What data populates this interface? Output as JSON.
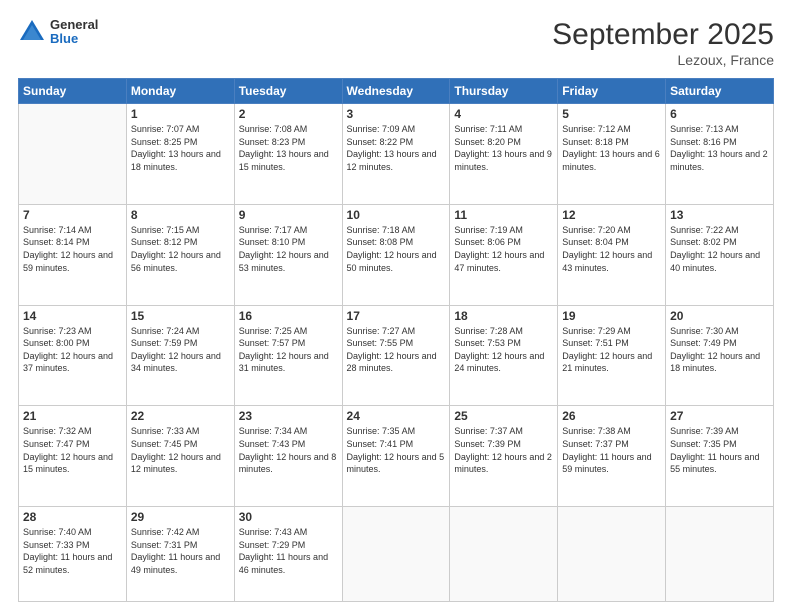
{
  "header": {
    "logo": {
      "general": "General",
      "blue": "Blue"
    },
    "title": "September 2025",
    "location": "Lezoux, France"
  },
  "weekdays": [
    "Sunday",
    "Monday",
    "Tuesday",
    "Wednesday",
    "Thursday",
    "Friday",
    "Saturday"
  ],
  "weeks": [
    [
      {
        "day": "",
        "sunrise": "",
        "sunset": "",
        "daylight": ""
      },
      {
        "day": "1",
        "sunrise": "Sunrise: 7:07 AM",
        "sunset": "Sunset: 8:25 PM",
        "daylight": "Daylight: 13 hours and 18 minutes."
      },
      {
        "day": "2",
        "sunrise": "Sunrise: 7:08 AM",
        "sunset": "Sunset: 8:23 PM",
        "daylight": "Daylight: 13 hours and 15 minutes."
      },
      {
        "day": "3",
        "sunrise": "Sunrise: 7:09 AM",
        "sunset": "Sunset: 8:22 PM",
        "daylight": "Daylight: 13 hours and 12 minutes."
      },
      {
        "day": "4",
        "sunrise": "Sunrise: 7:11 AM",
        "sunset": "Sunset: 8:20 PM",
        "daylight": "Daylight: 13 hours and 9 minutes."
      },
      {
        "day": "5",
        "sunrise": "Sunrise: 7:12 AM",
        "sunset": "Sunset: 8:18 PM",
        "daylight": "Daylight: 13 hours and 6 minutes."
      },
      {
        "day": "6",
        "sunrise": "Sunrise: 7:13 AM",
        "sunset": "Sunset: 8:16 PM",
        "daylight": "Daylight: 13 hours and 2 minutes."
      }
    ],
    [
      {
        "day": "7",
        "sunrise": "Sunrise: 7:14 AM",
        "sunset": "Sunset: 8:14 PM",
        "daylight": "Daylight: 12 hours and 59 minutes."
      },
      {
        "day": "8",
        "sunrise": "Sunrise: 7:15 AM",
        "sunset": "Sunset: 8:12 PM",
        "daylight": "Daylight: 12 hours and 56 minutes."
      },
      {
        "day": "9",
        "sunrise": "Sunrise: 7:17 AM",
        "sunset": "Sunset: 8:10 PM",
        "daylight": "Daylight: 12 hours and 53 minutes."
      },
      {
        "day": "10",
        "sunrise": "Sunrise: 7:18 AM",
        "sunset": "Sunset: 8:08 PM",
        "daylight": "Daylight: 12 hours and 50 minutes."
      },
      {
        "day": "11",
        "sunrise": "Sunrise: 7:19 AM",
        "sunset": "Sunset: 8:06 PM",
        "daylight": "Daylight: 12 hours and 47 minutes."
      },
      {
        "day": "12",
        "sunrise": "Sunrise: 7:20 AM",
        "sunset": "Sunset: 8:04 PM",
        "daylight": "Daylight: 12 hours and 43 minutes."
      },
      {
        "day": "13",
        "sunrise": "Sunrise: 7:22 AM",
        "sunset": "Sunset: 8:02 PM",
        "daylight": "Daylight: 12 hours and 40 minutes."
      }
    ],
    [
      {
        "day": "14",
        "sunrise": "Sunrise: 7:23 AM",
        "sunset": "Sunset: 8:00 PM",
        "daylight": "Daylight: 12 hours and 37 minutes."
      },
      {
        "day": "15",
        "sunrise": "Sunrise: 7:24 AM",
        "sunset": "Sunset: 7:59 PM",
        "daylight": "Daylight: 12 hours and 34 minutes."
      },
      {
        "day": "16",
        "sunrise": "Sunrise: 7:25 AM",
        "sunset": "Sunset: 7:57 PM",
        "daylight": "Daylight: 12 hours and 31 minutes."
      },
      {
        "day": "17",
        "sunrise": "Sunrise: 7:27 AM",
        "sunset": "Sunset: 7:55 PM",
        "daylight": "Daylight: 12 hours and 28 minutes."
      },
      {
        "day": "18",
        "sunrise": "Sunrise: 7:28 AM",
        "sunset": "Sunset: 7:53 PM",
        "daylight": "Daylight: 12 hours and 24 minutes."
      },
      {
        "day": "19",
        "sunrise": "Sunrise: 7:29 AM",
        "sunset": "Sunset: 7:51 PM",
        "daylight": "Daylight: 12 hours and 21 minutes."
      },
      {
        "day": "20",
        "sunrise": "Sunrise: 7:30 AM",
        "sunset": "Sunset: 7:49 PM",
        "daylight": "Daylight: 12 hours and 18 minutes."
      }
    ],
    [
      {
        "day": "21",
        "sunrise": "Sunrise: 7:32 AM",
        "sunset": "Sunset: 7:47 PM",
        "daylight": "Daylight: 12 hours and 15 minutes."
      },
      {
        "day": "22",
        "sunrise": "Sunrise: 7:33 AM",
        "sunset": "Sunset: 7:45 PM",
        "daylight": "Daylight: 12 hours and 12 minutes."
      },
      {
        "day": "23",
        "sunrise": "Sunrise: 7:34 AM",
        "sunset": "Sunset: 7:43 PM",
        "daylight": "Daylight: 12 hours and 8 minutes."
      },
      {
        "day": "24",
        "sunrise": "Sunrise: 7:35 AM",
        "sunset": "Sunset: 7:41 PM",
        "daylight": "Daylight: 12 hours and 5 minutes."
      },
      {
        "day": "25",
        "sunrise": "Sunrise: 7:37 AM",
        "sunset": "Sunset: 7:39 PM",
        "daylight": "Daylight: 12 hours and 2 minutes."
      },
      {
        "day": "26",
        "sunrise": "Sunrise: 7:38 AM",
        "sunset": "Sunset: 7:37 PM",
        "daylight": "Daylight: 11 hours and 59 minutes."
      },
      {
        "day": "27",
        "sunrise": "Sunrise: 7:39 AM",
        "sunset": "Sunset: 7:35 PM",
        "daylight": "Daylight: 11 hours and 55 minutes."
      }
    ],
    [
      {
        "day": "28",
        "sunrise": "Sunrise: 7:40 AM",
        "sunset": "Sunset: 7:33 PM",
        "daylight": "Daylight: 11 hours and 52 minutes."
      },
      {
        "day": "29",
        "sunrise": "Sunrise: 7:42 AM",
        "sunset": "Sunset: 7:31 PM",
        "daylight": "Daylight: 11 hours and 49 minutes."
      },
      {
        "day": "30",
        "sunrise": "Sunrise: 7:43 AM",
        "sunset": "Sunset: 7:29 PM",
        "daylight": "Daylight: 11 hours and 46 minutes."
      },
      {
        "day": "",
        "sunrise": "",
        "sunset": "",
        "daylight": ""
      },
      {
        "day": "",
        "sunrise": "",
        "sunset": "",
        "daylight": ""
      },
      {
        "day": "",
        "sunrise": "",
        "sunset": "",
        "daylight": ""
      },
      {
        "day": "",
        "sunrise": "",
        "sunset": "",
        "daylight": ""
      }
    ]
  ]
}
